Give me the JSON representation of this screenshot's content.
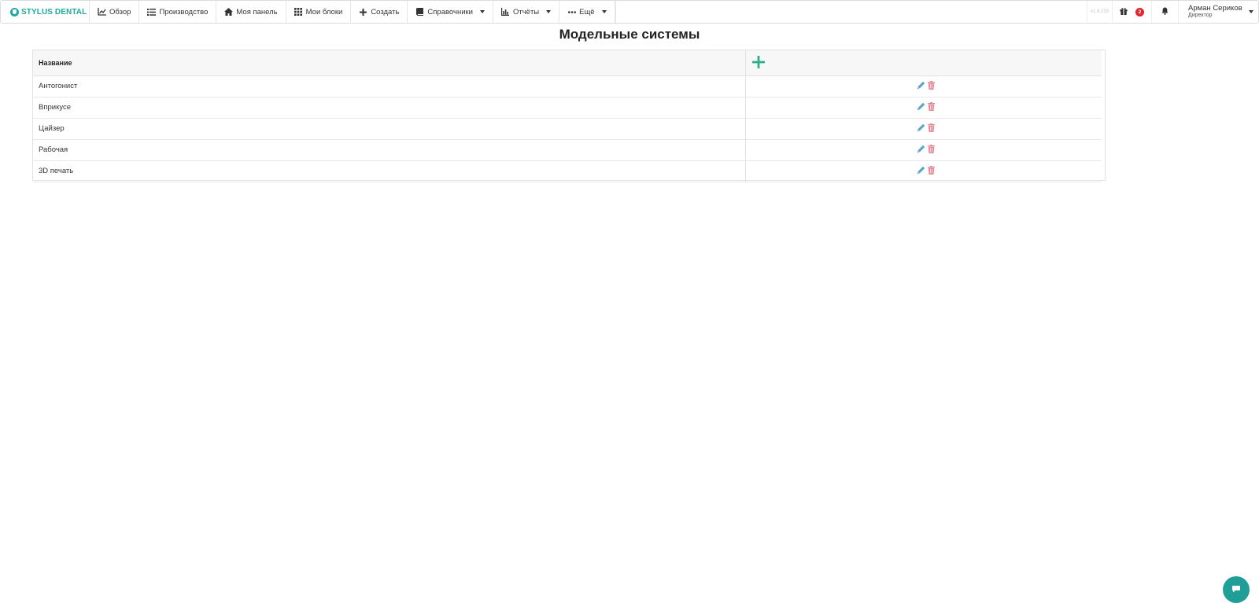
{
  "brand": {
    "name": "STYLUS DENTAL",
    "color": "#1fa8a0"
  },
  "nav": {
    "items": [
      {
        "label": "Обзор",
        "icon": "chart-line-icon",
        "dropdown": false
      },
      {
        "label": "Производство",
        "icon": "list-icon",
        "dropdown": false
      },
      {
        "label": "Моя панель",
        "icon": "home-icon",
        "dropdown": false
      },
      {
        "label": "Мои блоки",
        "icon": "grid-icon",
        "dropdown": false
      },
      {
        "label": "Создать",
        "icon": "plus-icon",
        "dropdown": false
      },
      {
        "label": "Справочники",
        "icon": "book-icon",
        "dropdown": true
      },
      {
        "label": "Отчёты",
        "icon": "bar-chart-icon",
        "dropdown": true
      },
      {
        "label": "Ещё",
        "icon": "ellipsis-icon",
        "dropdown": true
      }
    ],
    "version": "v1.6.233",
    "gift_badge": "2",
    "user": {
      "name": "Арман Сериков",
      "role": "Директор"
    }
  },
  "page": {
    "title": "Модельные системы"
  },
  "table": {
    "columns": [
      "Название",
      ""
    ],
    "rows": [
      {
        "name": "Антогонист"
      },
      {
        "name": "Вприкусе"
      },
      {
        "name": "Цайзер"
      },
      {
        "name": "Рабочая"
      },
      {
        "name": "3D печать"
      }
    ]
  },
  "colors": {
    "accent": "#1fa8a0",
    "add_icon": "#2fae8f",
    "edit_icon": "#5ba4c7",
    "delete_icon": "#e8899a",
    "badge": "#e0262b"
  }
}
